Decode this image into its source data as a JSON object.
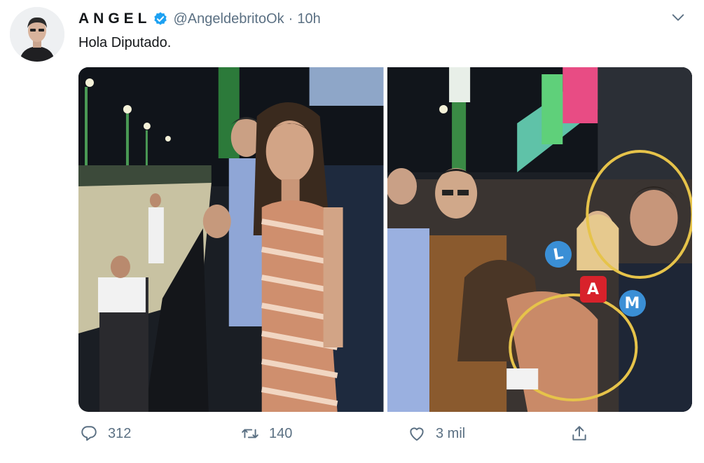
{
  "tweet": {
    "display_name": "ANGEL",
    "handle": "@AngeldebritoOk",
    "separator": "·",
    "time": "10h",
    "text": "Hola Diputado."
  },
  "media": {
    "badges": [
      "L",
      "A",
      "M"
    ]
  },
  "actions": {
    "reply_count": "312",
    "retweet_count": "140",
    "like_count": "3 mil"
  },
  "colors": {
    "verified": "#1da1f2",
    "secondary_text": "#5b7083",
    "badge_blue": "#3a8fd6",
    "badge_red": "#d8222b",
    "annotation_circle": "#e6c34a"
  },
  "icons": [
    "verified-badge-icon",
    "chevron-down-icon",
    "reply-icon",
    "retweet-icon",
    "like-icon",
    "share-icon"
  ]
}
